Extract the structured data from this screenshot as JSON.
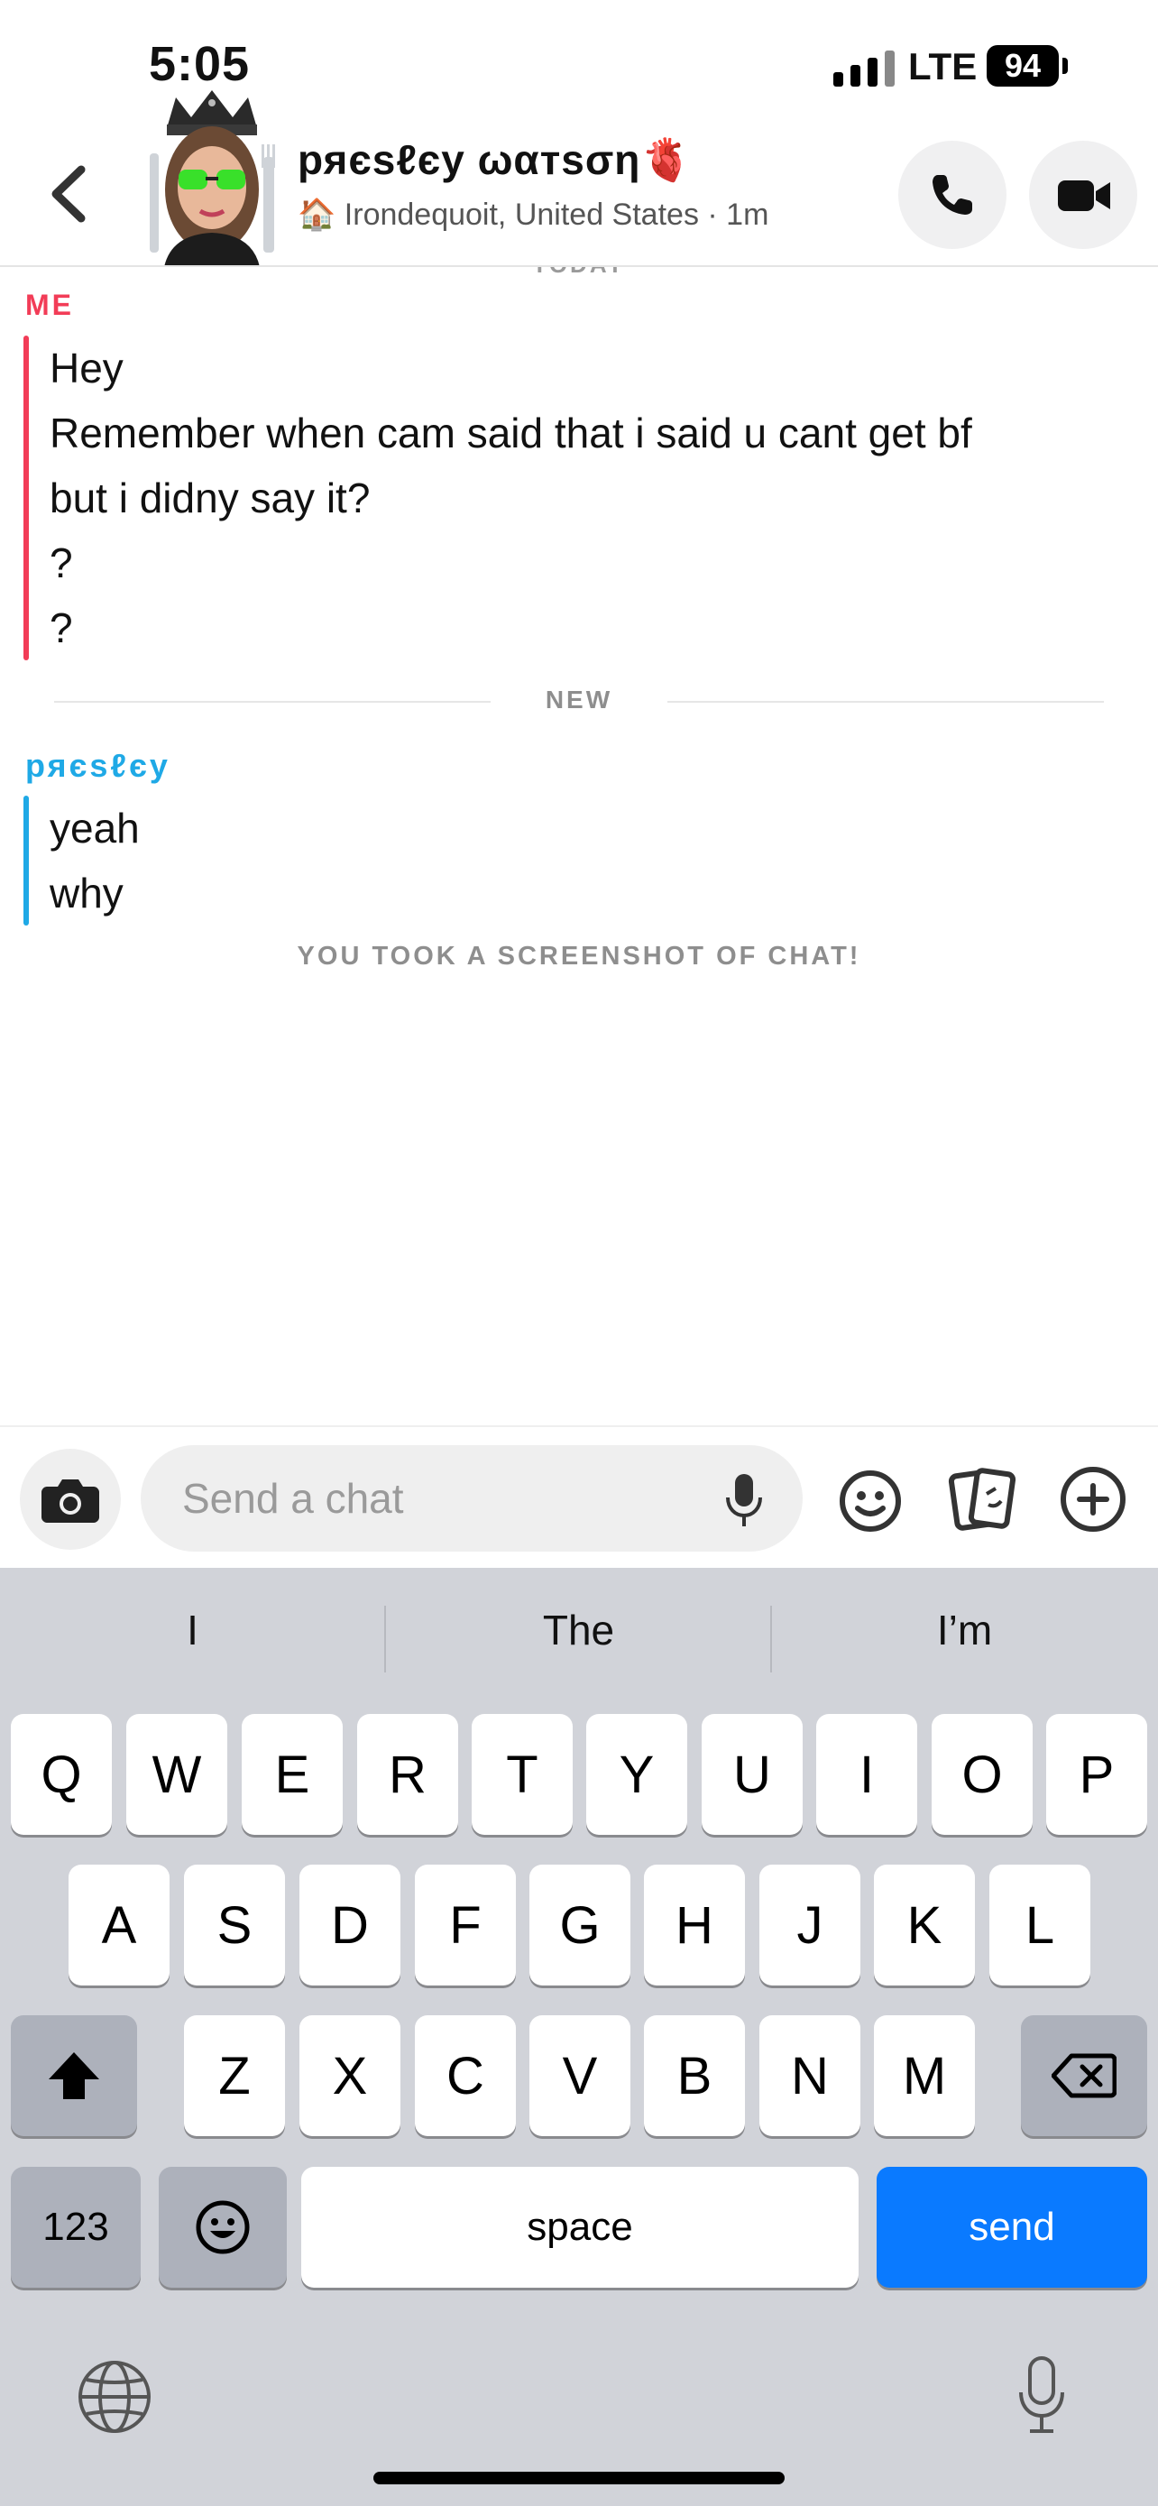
{
  "status_bar": {
    "time": "5:05",
    "network": "LTE",
    "battery": "94"
  },
  "header": {
    "contact_name": "ряєsℓєy ωαтsση🫀",
    "location_emoji": "🏠",
    "location": "Irondequoit, United States · 1m"
  },
  "chat": {
    "date_label": "TODAY",
    "me": {
      "sender": "ME",
      "messages": [
        "Hey",
        "Remember when cam said that i said u cant get bf",
        "but i didny say it?",
        "?",
        "?"
      ]
    },
    "new_label": "NEW",
    "presley": {
      "sender": "ряєsℓєy",
      "messages": [
        "yeah",
        "why"
      ]
    },
    "screenshot_notice": "YOU TOOK A SCREENSHOT OF CHAT!"
  },
  "composer": {
    "placeholder": "Send a chat"
  },
  "keyboard": {
    "suggestions": [
      "I",
      "The",
      "I’m"
    ],
    "row1": [
      "Q",
      "W",
      "E",
      "R",
      "T",
      "Y",
      "U",
      "I",
      "O",
      "P"
    ],
    "row2": [
      "A",
      "S",
      "D",
      "F",
      "G",
      "H",
      "J",
      "K",
      "L"
    ],
    "row3": [
      "Z",
      "X",
      "C",
      "V",
      "B",
      "N",
      "M"
    ],
    "numbers_key": "123",
    "space_key": "space",
    "send_key": "send"
  },
  "colors": {
    "me": "#f23c57",
    "presley": "#1fa9e6",
    "send": "#0a7aff",
    "keyboard_bg": "#d1d3d9"
  }
}
